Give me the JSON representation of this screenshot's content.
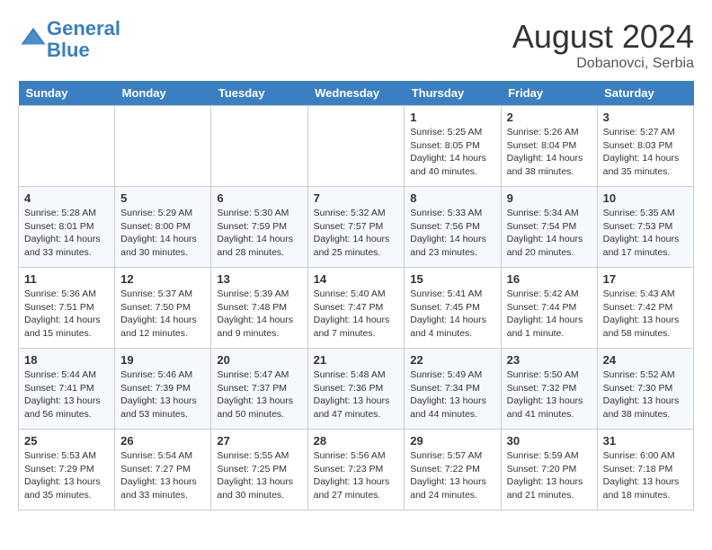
{
  "logo": {
    "line1": "General",
    "line2": "Blue"
  },
  "title": "August 2024",
  "location": "Dobanovci, Serbia",
  "days_header": [
    "Sunday",
    "Monday",
    "Tuesday",
    "Wednesday",
    "Thursday",
    "Friday",
    "Saturday"
  ],
  "weeks": [
    [
      {
        "day": "",
        "content": ""
      },
      {
        "day": "",
        "content": ""
      },
      {
        "day": "",
        "content": ""
      },
      {
        "day": "",
        "content": ""
      },
      {
        "day": "1",
        "content": "Sunrise: 5:25 AM\nSunset: 8:05 PM\nDaylight: 14 hours\nand 40 minutes."
      },
      {
        "day": "2",
        "content": "Sunrise: 5:26 AM\nSunset: 8:04 PM\nDaylight: 14 hours\nand 38 minutes."
      },
      {
        "day": "3",
        "content": "Sunrise: 5:27 AM\nSunset: 8:03 PM\nDaylight: 14 hours\nand 35 minutes."
      }
    ],
    [
      {
        "day": "4",
        "content": "Sunrise: 5:28 AM\nSunset: 8:01 PM\nDaylight: 14 hours\nand 33 minutes."
      },
      {
        "day": "5",
        "content": "Sunrise: 5:29 AM\nSunset: 8:00 PM\nDaylight: 14 hours\nand 30 minutes."
      },
      {
        "day": "6",
        "content": "Sunrise: 5:30 AM\nSunset: 7:59 PM\nDaylight: 14 hours\nand 28 minutes."
      },
      {
        "day": "7",
        "content": "Sunrise: 5:32 AM\nSunset: 7:57 PM\nDaylight: 14 hours\nand 25 minutes."
      },
      {
        "day": "8",
        "content": "Sunrise: 5:33 AM\nSunset: 7:56 PM\nDaylight: 14 hours\nand 23 minutes."
      },
      {
        "day": "9",
        "content": "Sunrise: 5:34 AM\nSunset: 7:54 PM\nDaylight: 14 hours\nand 20 minutes."
      },
      {
        "day": "10",
        "content": "Sunrise: 5:35 AM\nSunset: 7:53 PM\nDaylight: 14 hours\nand 17 minutes."
      }
    ],
    [
      {
        "day": "11",
        "content": "Sunrise: 5:36 AM\nSunset: 7:51 PM\nDaylight: 14 hours\nand 15 minutes."
      },
      {
        "day": "12",
        "content": "Sunrise: 5:37 AM\nSunset: 7:50 PM\nDaylight: 14 hours\nand 12 minutes."
      },
      {
        "day": "13",
        "content": "Sunrise: 5:39 AM\nSunset: 7:48 PM\nDaylight: 14 hours\nand 9 minutes."
      },
      {
        "day": "14",
        "content": "Sunrise: 5:40 AM\nSunset: 7:47 PM\nDaylight: 14 hours\nand 7 minutes."
      },
      {
        "day": "15",
        "content": "Sunrise: 5:41 AM\nSunset: 7:45 PM\nDaylight: 14 hours\nand 4 minutes."
      },
      {
        "day": "16",
        "content": "Sunrise: 5:42 AM\nSunset: 7:44 PM\nDaylight: 14 hours\nand 1 minute."
      },
      {
        "day": "17",
        "content": "Sunrise: 5:43 AM\nSunset: 7:42 PM\nDaylight: 13 hours\nand 58 minutes."
      }
    ],
    [
      {
        "day": "18",
        "content": "Sunrise: 5:44 AM\nSunset: 7:41 PM\nDaylight: 13 hours\nand 56 minutes."
      },
      {
        "day": "19",
        "content": "Sunrise: 5:46 AM\nSunset: 7:39 PM\nDaylight: 13 hours\nand 53 minutes."
      },
      {
        "day": "20",
        "content": "Sunrise: 5:47 AM\nSunset: 7:37 PM\nDaylight: 13 hours\nand 50 minutes."
      },
      {
        "day": "21",
        "content": "Sunrise: 5:48 AM\nSunset: 7:36 PM\nDaylight: 13 hours\nand 47 minutes."
      },
      {
        "day": "22",
        "content": "Sunrise: 5:49 AM\nSunset: 7:34 PM\nDaylight: 13 hours\nand 44 minutes."
      },
      {
        "day": "23",
        "content": "Sunrise: 5:50 AM\nSunset: 7:32 PM\nDaylight: 13 hours\nand 41 minutes."
      },
      {
        "day": "24",
        "content": "Sunrise: 5:52 AM\nSunset: 7:30 PM\nDaylight: 13 hours\nand 38 minutes."
      }
    ],
    [
      {
        "day": "25",
        "content": "Sunrise: 5:53 AM\nSunset: 7:29 PM\nDaylight: 13 hours\nand 35 minutes."
      },
      {
        "day": "26",
        "content": "Sunrise: 5:54 AM\nSunset: 7:27 PM\nDaylight: 13 hours\nand 33 minutes."
      },
      {
        "day": "27",
        "content": "Sunrise: 5:55 AM\nSunset: 7:25 PM\nDaylight: 13 hours\nand 30 minutes."
      },
      {
        "day": "28",
        "content": "Sunrise: 5:56 AM\nSunset: 7:23 PM\nDaylight: 13 hours\nand 27 minutes."
      },
      {
        "day": "29",
        "content": "Sunrise: 5:57 AM\nSunset: 7:22 PM\nDaylight: 13 hours\nand 24 minutes."
      },
      {
        "day": "30",
        "content": "Sunrise: 5:59 AM\nSunset: 7:20 PM\nDaylight: 13 hours\nand 21 minutes."
      },
      {
        "day": "31",
        "content": "Sunrise: 6:00 AM\nSunset: 7:18 PM\nDaylight: 13 hours\nand 18 minutes."
      }
    ]
  ]
}
